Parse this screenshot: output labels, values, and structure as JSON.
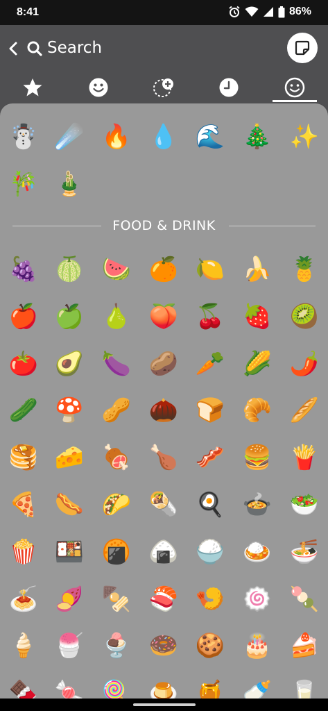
{
  "status": {
    "time": "8:41",
    "battery": "86%"
  },
  "header": {
    "search_placeholder": "Search"
  },
  "tabs": [
    {
      "icon": "star-icon"
    },
    {
      "icon": "smiley-icon"
    },
    {
      "icon": "custom-sticker-icon"
    },
    {
      "icon": "recent-clock-icon"
    },
    {
      "icon": "emoji-icon",
      "selected": true
    }
  ],
  "top_rows": [
    [
      "☃️",
      "☄️",
      "🔥",
      "💧",
      "🌊",
      "🎄",
      "✨"
    ],
    [
      "🎋",
      "🎍"
    ]
  ],
  "section": {
    "title": "FOOD & DRINK"
  },
  "food_rows": [
    [
      "🍇",
      "🍈",
      "🍉",
      "🍊",
      "🍋",
      "🍌",
      "🍍"
    ],
    [
      "🍎",
      "🍏",
      "🍐",
      "🍑",
      "🍒",
      "🍓",
      "🥝"
    ],
    [
      "🍅",
      "🥑",
      "🍆",
      "🥔",
      "🥕",
      "🌽",
      "🌶️"
    ],
    [
      "🥒",
      "🍄",
      "🥜",
      "🌰",
      "🍞",
      "🥐",
      "🥖"
    ],
    [
      "🥞",
      "🧀",
      "🍖",
      "🍗",
      "🥓",
      "🍔",
      "🍟"
    ],
    [
      "🍕",
      "🌭",
      "🌮",
      "🌯",
      "🍳",
      "🍲",
      "🥗"
    ],
    [
      "🍿",
      "🍱",
      "🍘",
      "🍙",
      "🍚",
      "🍛",
      "🍜"
    ],
    [
      "🍝",
      "🍠",
      "🍢",
      "🍣",
      "🍤",
      "🍥",
      "🍡"
    ],
    [
      "🍦",
      "🍧",
      "🍨",
      "🍩",
      "🍪",
      "🎂",
      "🍰"
    ],
    [
      "🍫",
      "🍬",
      "🍭",
      "🍮",
      "🍯",
      "🍼",
      "🥛"
    ]
  ]
}
